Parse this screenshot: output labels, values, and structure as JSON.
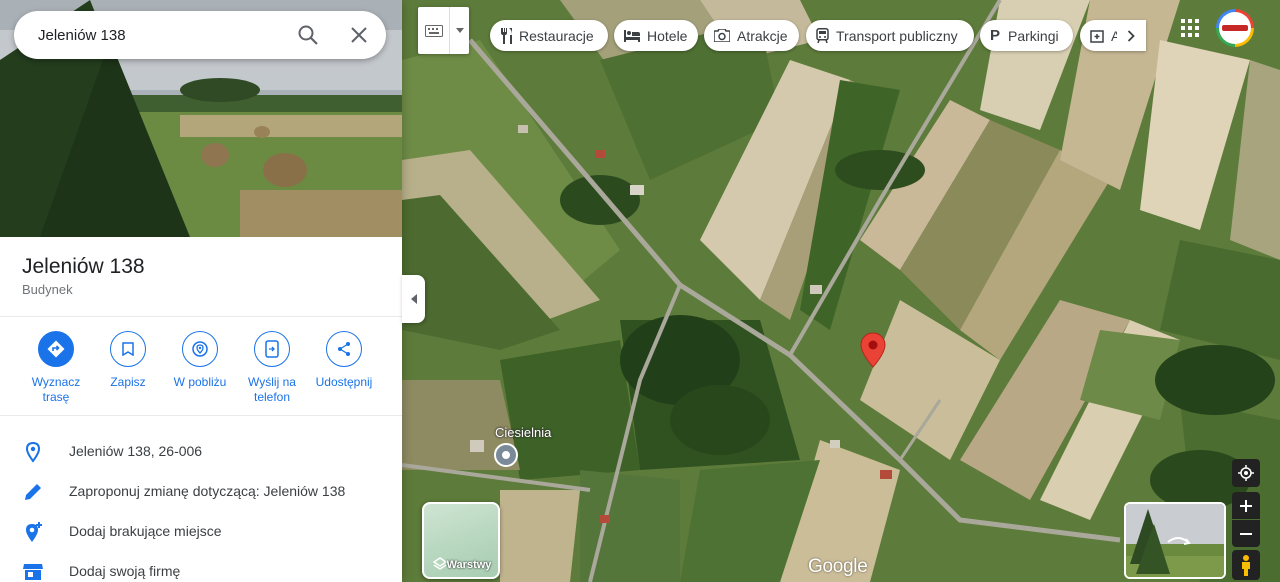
{
  "search": {
    "value": "Jeleniów 138"
  },
  "place": {
    "title": "Jeleniów 138",
    "category": "Budynek"
  },
  "actions": [
    {
      "label": "Wyznacz trasę",
      "icon": "directions-icon"
    },
    {
      "label": "Zapisz",
      "icon": "bookmark-icon"
    },
    {
      "label": "W pobliżu",
      "icon": "nearby-icon"
    },
    {
      "label": "Wyślij na telefon",
      "icon": "send-to-phone-icon"
    },
    {
      "label": "Udostępnij",
      "icon": "share-icon"
    }
  ],
  "details": [
    {
      "text": "Jeleniów 138, 26-006",
      "icon": "location-pin-icon"
    },
    {
      "text": "Zaproponuj zmianę dotyczącą: Jeleniów 138",
      "icon": "pencil-icon"
    },
    {
      "text": "Dodaj brakujące miejsce",
      "icon": "add-place-icon"
    },
    {
      "text": "Dodaj swoją firmę",
      "icon": "storefront-icon"
    }
  ],
  "chips": [
    {
      "label": "Restauracje",
      "icon": "restaurant-icon"
    },
    {
      "label": "Hotele",
      "icon": "hotel-icon"
    },
    {
      "label": "Atrakcje",
      "icon": "camera-icon"
    },
    {
      "label": "Transport publiczny",
      "icon": "transit-icon"
    },
    {
      "label": "Parkingi",
      "icon": "parking-icon"
    },
    {
      "label": "A",
      "icon": "pharmacy-icon"
    }
  ],
  "map": {
    "poi_label": "Ciesielnia",
    "layers_label": "Warstwy",
    "logo": "Google",
    "marker_color": "#ea4335"
  },
  "colors": {
    "accent": "#1a73e8"
  }
}
